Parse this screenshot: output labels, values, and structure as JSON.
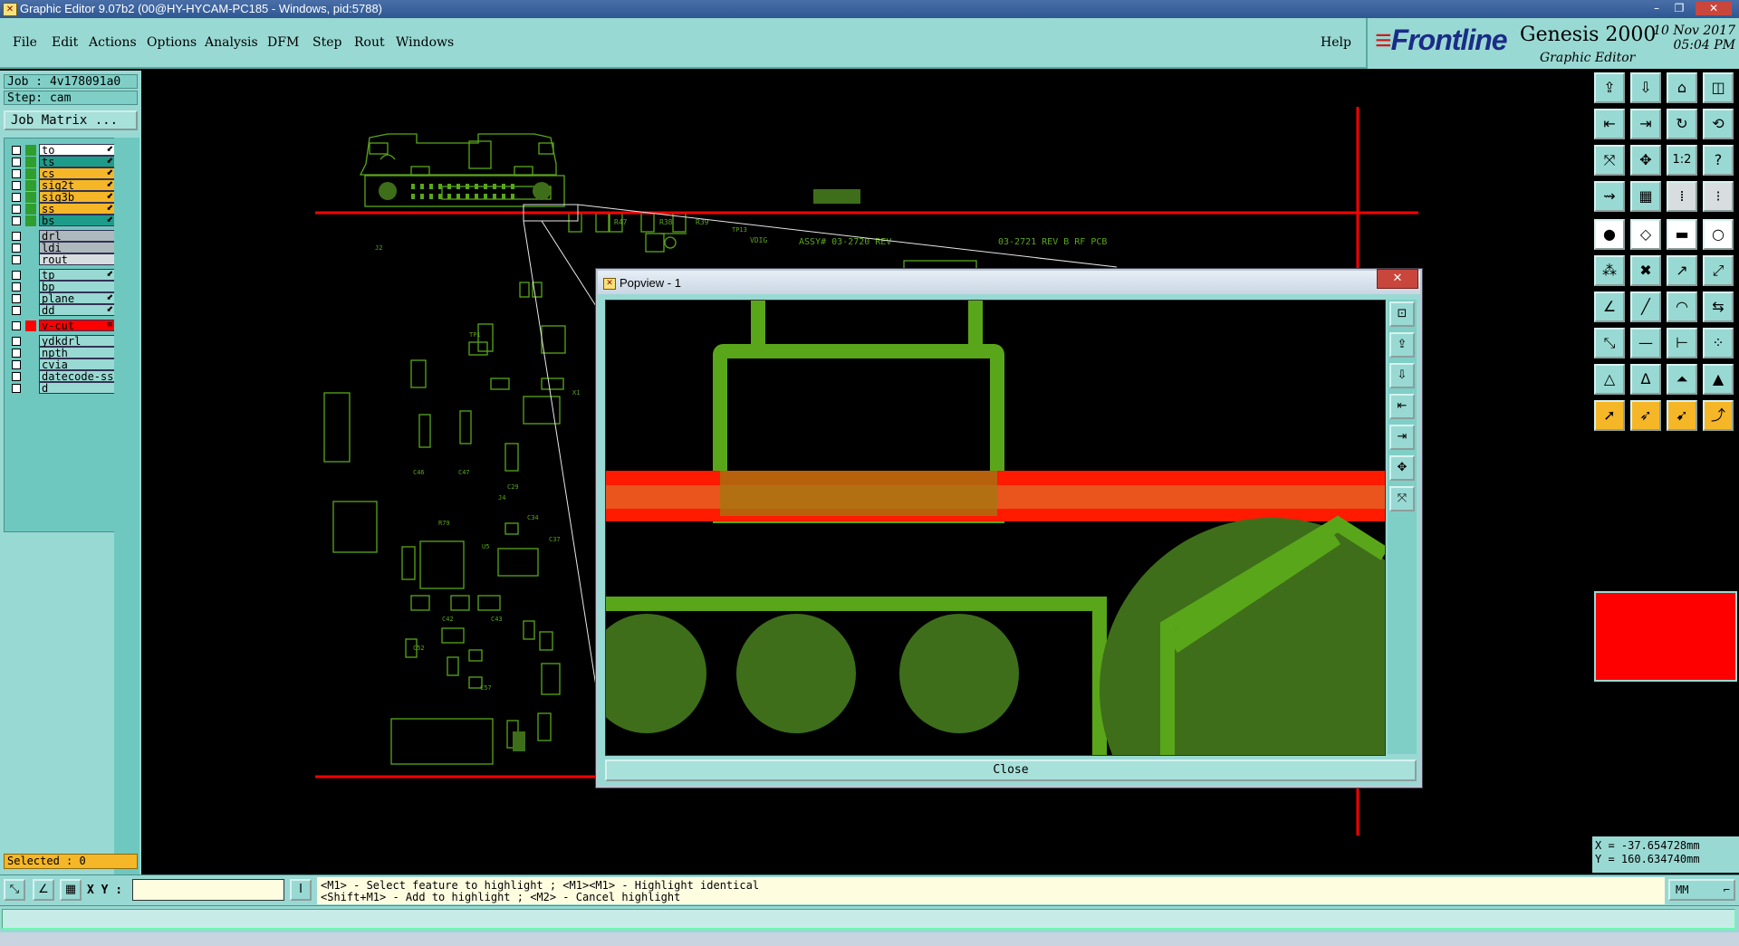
{
  "window": {
    "title": "Graphic Editor 9.07b2 (00@HY-HYCAM-PC185 - Windows, pid:5788)",
    "controls": [
      "–",
      "❐",
      "✕"
    ]
  },
  "menu": {
    "items": [
      {
        "label": "File"
      },
      {
        "label": "Edit"
      },
      {
        "label": "Actions"
      },
      {
        "label": "Options"
      },
      {
        "label": "Analysis"
      },
      {
        "label": "DFM"
      },
      {
        "label": "Step"
      },
      {
        "label": "Rout"
      },
      {
        "label": "Windows"
      }
    ],
    "help": "Help"
  },
  "brand": {
    "logo": "Frontline",
    "product": "Genesis 2000",
    "subtitle": "Graphic Editor",
    "date": "10 Nov 2017",
    "time": "05:04 PM"
  },
  "job": {
    "job_line": "Job : 4v178091a0",
    "step_line": "Step: cam",
    "matrix_button": "Job Matrix ..."
  },
  "layers": [
    {
      "name": "to",
      "color": "#2f9e2f",
      "bg": "#ffffff",
      "arrow": "⬋"
    },
    {
      "name": "ts",
      "color": "#2f9e2f",
      "bg": "#1e9c8a",
      "arrow": "⬋"
    },
    {
      "name": "cs",
      "color": "#2f9e2f",
      "bg": "#f5b728",
      "arrow": "⬋"
    },
    {
      "name": "sig2t",
      "color": "#2f9e2f",
      "bg": "#f5b728",
      "arrow": "⬋"
    },
    {
      "name": "sig3b",
      "color": "#2f9e2f",
      "bg": "#f5b728",
      "arrow": "⬋"
    },
    {
      "name": "ss",
      "color": "#2f9e2f",
      "bg": "#f5b728",
      "arrow": "⬋"
    },
    {
      "name": "bs",
      "color": "#2f9e2f",
      "bg": "#1e9c8a",
      "arrow": "⬋"
    },
    {
      "name": "drl",
      "color": "",
      "bg": "#aeb9bd",
      "arrow": ""
    },
    {
      "name": "ldi",
      "color": "",
      "bg": "#aeb9bd",
      "arrow": ""
    },
    {
      "name": "rout",
      "color": "",
      "bg": "#d8dedf",
      "arrow": ""
    },
    {
      "name": "tp",
      "color": "",
      "bg": "#99d9d3",
      "arrow": "⬋"
    },
    {
      "name": "bp",
      "color": "",
      "bg": "#99d9d3",
      "arrow": ""
    },
    {
      "name": "plane",
      "color": "",
      "bg": "#99d9d3",
      "arrow": "⬋"
    },
    {
      "name": "dd",
      "color": "",
      "bg": "#99d9d3",
      "arrow": "⬋"
    },
    {
      "name": "v-cut",
      "color": "#ff0000",
      "bg": "#ff0000",
      "arrow": "≡"
    },
    {
      "name": "ydkdrl",
      "color": "",
      "bg": "#99d9d3",
      "arrow": ""
    },
    {
      "name": "npth",
      "color": "",
      "bg": "#99d9d3",
      "arrow": ""
    },
    {
      "name": "cvia",
      "color": "",
      "bg": "#99d9d3",
      "arrow": ""
    },
    {
      "name": "datecode-ss",
      "color": "",
      "bg": "#99d9d3",
      "arrow": ""
    },
    {
      "name": "d",
      "color": "",
      "bg": "#99d9d3",
      "arrow": ""
    }
  ],
  "selected": "Selected : 0",
  "pcb_labels": {
    "assy": "ASSY# 03-2720 REV",
    "rev": "03-2721 REV B RF PCB",
    "r47": "R47",
    "r38": "R38",
    "r39": "R39",
    "vdig": "VDIG",
    "tp13": "TP13",
    "j2": "J2",
    "j4": "J4",
    "u5": "U5",
    "c37": "C37",
    "c42": "C42",
    "c43": "C43",
    "c46": "C46",
    "c47": "C47",
    "c29": "C29",
    "r79": "R79",
    "c34": "C34",
    "c52": "C52",
    "c57": "C57",
    "x1": "X1",
    "tp1": "TP1"
  },
  "popview": {
    "title": "Popview - 1",
    "close_button": "Close"
  },
  "coords": {
    "x": "X = -37.654728mm",
    "y": "Y = 160.634740mm"
  },
  "bottom": {
    "xy_label": "X Y :",
    "xy_value": "",
    "help_line1": "<M1> - Select feature to highlight ; <M1><M1> - Highlight identical",
    "help_line2": "<Shift+M1> - Add to highlight ; <M2> - Cancel highlight",
    "units": "MM"
  },
  "colors": {
    "accent": "#99d9d3",
    "trace": "#5aa61a",
    "vcut": "#ff0000",
    "highlight": "#f5b728"
  }
}
